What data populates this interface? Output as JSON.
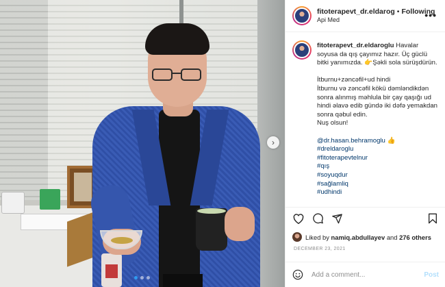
{
  "post": {
    "username": "fitoterapevt_dr.eldarog",
    "separator": "•",
    "follow_label": "Following",
    "subtitle": "Api Med",
    "more_label": "•••",
    "carousel_next": "›"
  },
  "caption": {
    "username": "fitoterapevt_dr.eldaroglu",
    "intro": "Havalar soyusa da qış çayımız hazır. Üç güclü bitki yanımızda. 👉Şəkli sola sürüşdürün.",
    "recipe_line1": "İtburnu+zəncəfil+ud hindi",
    "recipe_body": "İtburnu və zəncəfil kökü dəmləndikdən sonra alınmış məhlula bir çay qaşığı ud hindi əlavə edib gündə iki dəfə yemakdan sonra qəbul edin.",
    "closing": "Nuş olsun!",
    "mention": "@dr.hasan.behramoglu 👍",
    "hashtags": [
      "#dreldaroglu",
      "#fitoterapevtelnur",
      "#qış",
      "#soyuqdur",
      "#sağlamliq",
      "#udhindi"
    ]
  },
  "likes": {
    "prefix": "Liked by ",
    "user": "namiq.abdullayev",
    "middle": " and ",
    "others": "276 others"
  },
  "date": "DECEMBER 23, 2021",
  "comment": {
    "placeholder": "Add a comment...",
    "post_label": "Post"
  },
  "icons": {
    "like": "heart-icon",
    "comment": "comment-icon",
    "share": "share-icon",
    "save": "bookmark-icon",
    "emoji": "emoji-icon"
  },
  "colors": {
    "link": "#00376b",
    "muted": "#8e8e8e",
    "post_button": "#b2dffc",
    "active_dot": "#2f9bf0"
  }
}
